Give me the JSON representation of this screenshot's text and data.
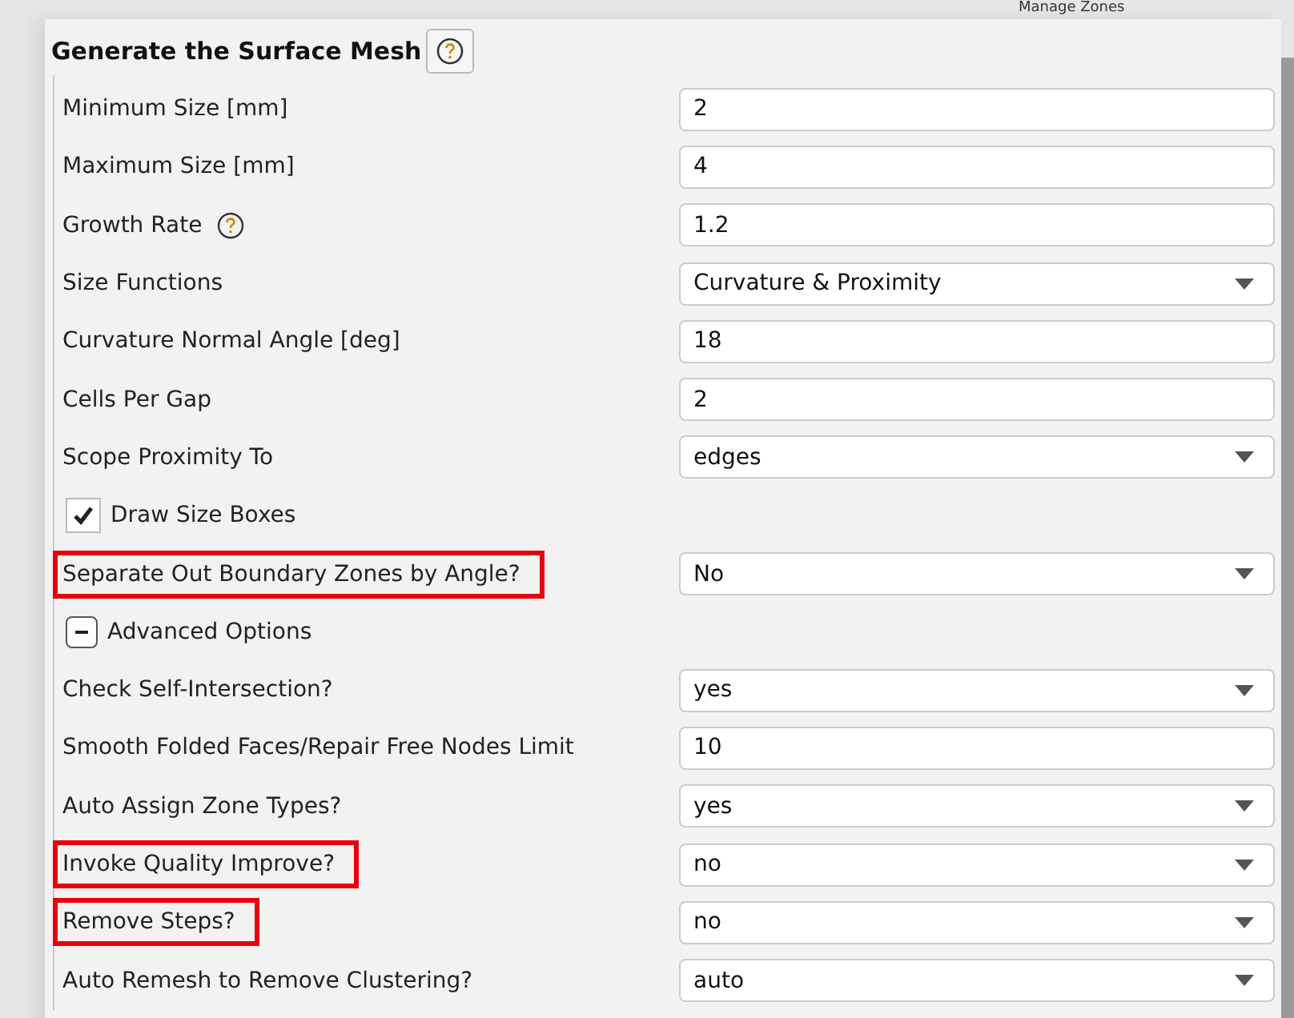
{
  "background_tree": {
    "item": "Manage Zones"
  },
  "panel": {
    "title": "Generate the Surface Mesh"
  },
  "rows": [
    {
      "kind": "text",
      "label": "Minimum Size [mm]",
      "value": "2",
      "highlighted": false
    },
    {
      "kind": "text",
      "label": "Maximum Size [mm]",
      "value": "4",
      "highlighted": false
    },
    {
      "kind": "text",
      "label": "Growth Rate",
      "value": "1.2",
      "help": true,
      "highlighted": false
    },
    {
      "kind": "dropdown",
      "label": "Size Functions",
      "value": "Curvature & Proximity",
      "highlighted": false
    },
    {
      "kind": "text",
      "label": "Curvature Normal Angle [deg]",
      "value": "18",
      "highlighted": false
    },
    {
      "kind": "text",
      "label": "Cells Per Gap",
      "value": "2",
      "highlighted": false
    },
    {
      "kind": "dropdown",
      "label": "Scope Proximity To",
      "value": "edges",
      "highlighted": false
    },
    {
      "kind": "checkbox",
      "label": "Draw Size Boxes",
      "checked": true
    },
    {
      "kind": "dropdown",
      "label": "Separate Out Boundary Zones by Angle?",
      "value": "No",
      "highlighted": true
    },
    {
      "kind": "section",
      "label": "Advanced Options",
      "expanded": true
    },
    {
      "kind": "dropdown",
      "label": "Check Self-Intersection?",
      "value": "yes",
      "highlighted": false
    },
    {
      "kind": "text",
      "label": "Smooth Folded Faces/Repair Free Nodes Limit",
      "value": "10",
      "highlighted": false
    },
    {
      "kind": "dropdown",
      "label": "Auto Assign Zone Types?",
      "value": "yes",
      "highlighted": false
    },
    {
      "kind": "dropdown",
      "label": "Invoke Quality Improve?",
      "value": "no",
      "highlighted": true
    },
    {
      "kind": "dropdown",
      "label": "Remove Steps?",
      "value": "no",
      "highlighted": true
    },
    {
      "kind": "dropdown",
      "label": "Auto Remesh to Remove Clustering?",
      "value": "auto",
      "highlighted": false
    }
  ]
}
